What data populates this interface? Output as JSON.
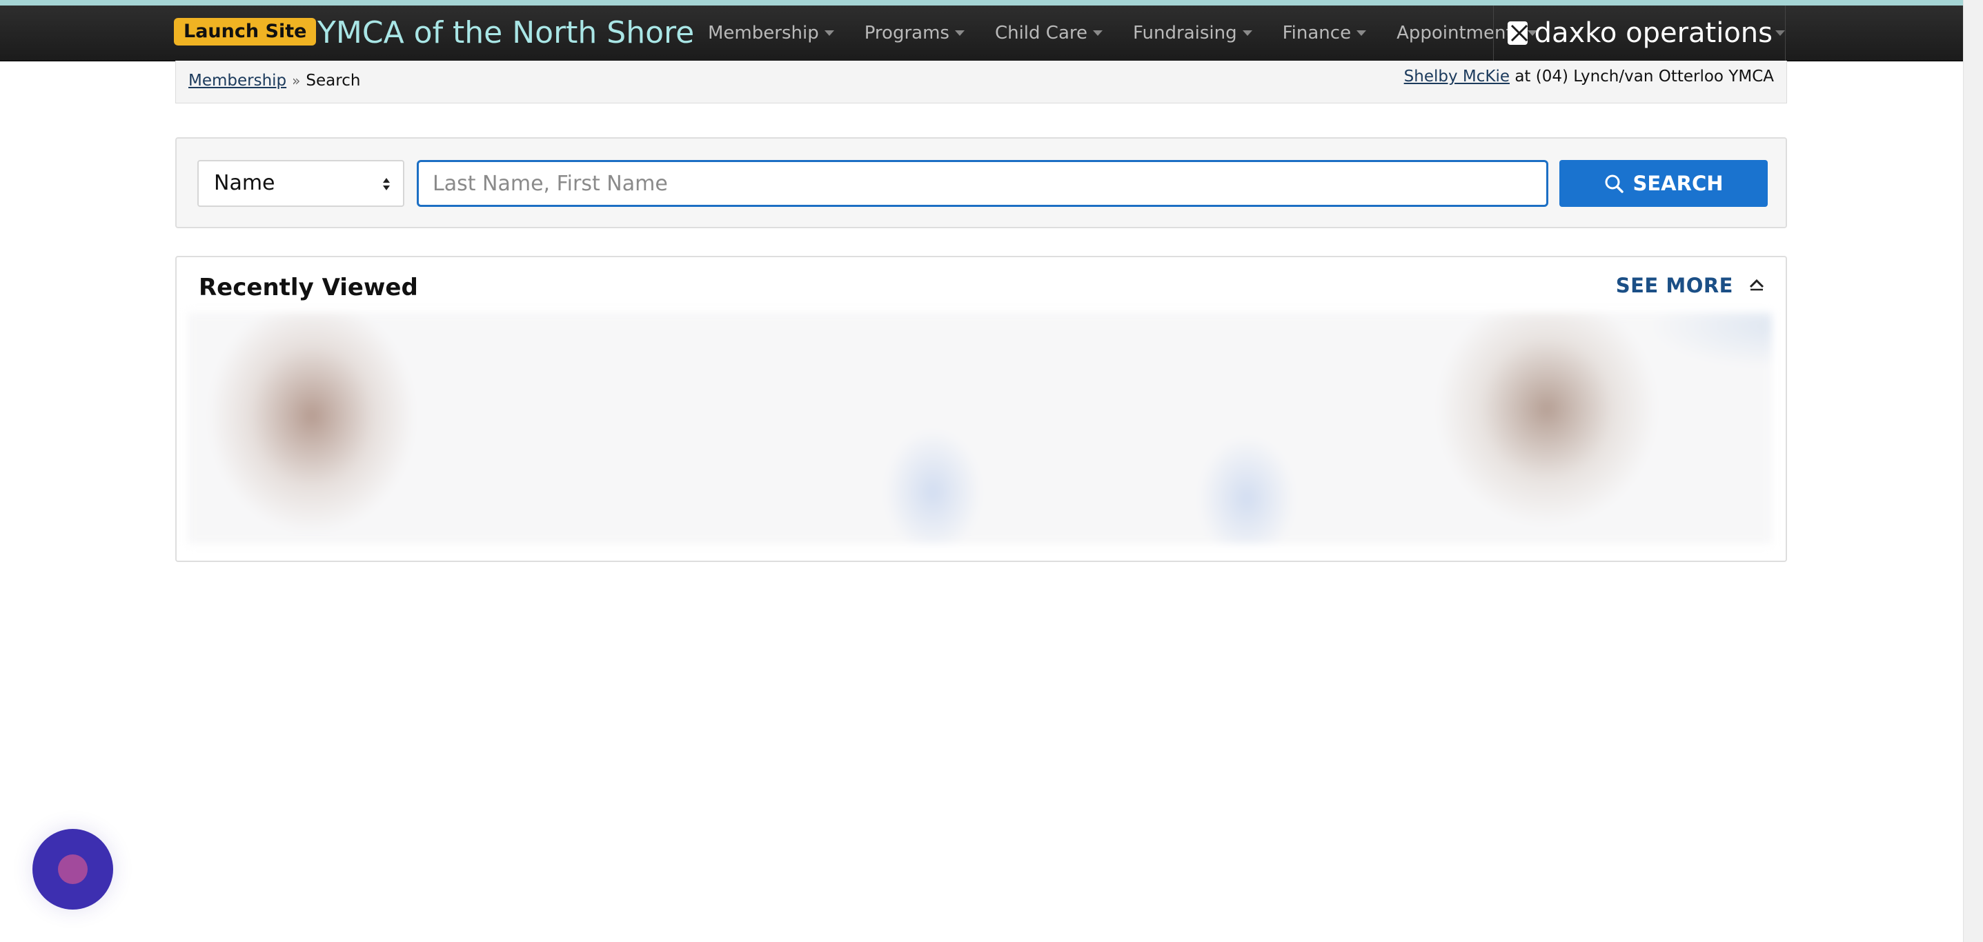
{
  "header": {
    "launch_site": "Launch Site",
    "org_name": "YMCA of the North Shore",
    "nav": [
      "Membership",
      "Programs",
      "Child Care",
      "Fundraising",
      "Finance",
      "Appointments"
    ],
    "brand": "daxko operations"
  },
  "breadcrumb": {
    "parent": "Membership",
    "current": "Search"
  },
  "user": {
    "name": "Shelby McKie",
    "location": "at (04) Lynch/van Otterloo YMCA"
  },
  "search": {
    "type_selected": "Name",
    "value": "",
    "placeholder": "Last Name, First Name",
    "button_label": "SEARCH"
  },
  "recent": {
    "title": "Recently Viewed",
    "see_more": "SEE MORE"
  },
  "colors": {
    "accent": "#a6d6d6",
    "launch": "#f0b323",
    "primary": "#1a73cf",
    "chat": "#3d2fb0"
  }
}
